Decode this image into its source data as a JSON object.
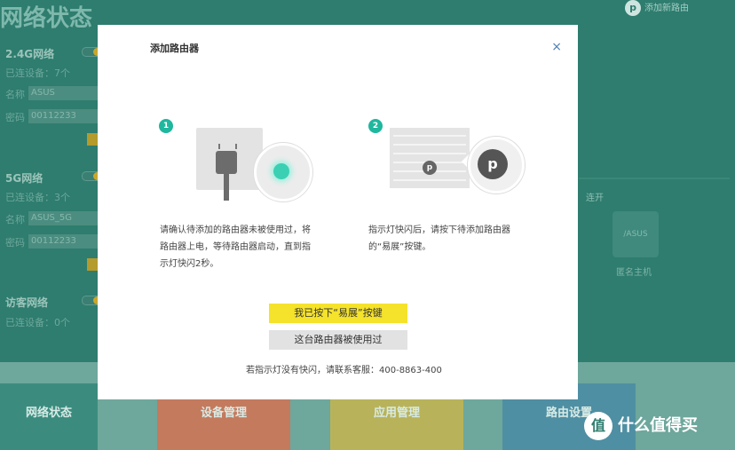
{
  "background": {
    "title": "网络状态",
    "add_router_label": "添加新路由",
    "sections": [
      {
        "title": "2.4G网络",
        "connected": "已连设备：7个",
        "name_label": "名称",
        "name_value": "ASUS",
        "pwd_label": "密码",
        "pwd_value": "00112233"
      },
      {
        "title": "5G网络",
        "connected": "已连设备：3个",
        "name_label": "名称",
        "name_value": "ASUS_5G",
        "pwd_label": "密码",
        "pwd_value": "00112233"
      },
      {
        "title": "访客网络",
        "connected": "已连设备：0个"
      }
    ],
    "connect_label": "连开",
    "asus_label": "/ASUS",
    "anon_host_label": "匿名主机",
    "tiles": [
      "网络状态",
      "设备管理",
      "应用管理",
      "路由设置"
    ]
  },
  "modal": {
    "title": "添加路由器",
    "close_symbol": "×",
    "step1_number": "1",
    "step2_number": "2",
    "step1_desc": "请确认待添加的路由器未被使用过，将路由器上电，等待路由器启动，直到指示灯快闪2秒。",
    "step2_desc": "指示灯快闪后，请按下待添加路由器的“易展”按键。",
    "router_logo": "p",
    "button_primary": "我已按下“易展”按键",
    "button_secondary": "这台路由器被使用过",
    "support_text": "若指示灯没有快闪，请联系客服：400-8863-400"
  },
  "watermark": {
    "logo": "值",
    "text": "什么值得买"
  },
  "colors": {
    "accent": "#1fb79e",
    "primary_button": "#f5e22b",
    "secondary_button": "#e2e2e2",
    "close": "#4f7fb2"
  }
}
